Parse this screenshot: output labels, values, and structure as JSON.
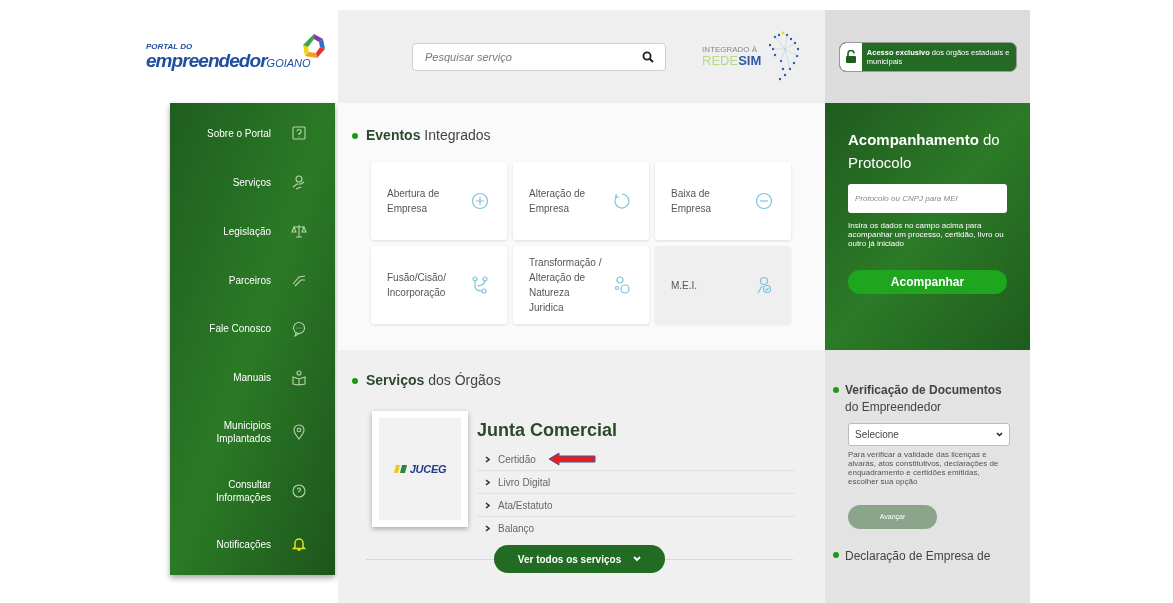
{
  "logo": {
    "small": "PORTAL DO",
    "main": "empreendedor",
    "suffix": "GOIANO"
  },
  "search": {
    "placeholder": "Pesquisar serviço"
  },
  "redesim": {
    "label": "INTEGRADO À",
    "rede": "REDE",
    "sim": "SIM"
  },
  "access_button": {
    "label": "**Acesso exclusivo** dos órgãos estaduais e municipais"
  },
  "sidebar": {
    "items": [
      {
        "label": "Sobre o Portal"
      },
      {
        "label": "Serviços"
      },
      {
        "label": "Legislação"
      },
      {
        "label": "Parceiros"
      },
      {
        "label": "Fale Conosco"
      },
      {
        "label": "Manuais"
      },
      {
        "label": "Municipios Implantados"
      },
      {
        "label": "Consultar Informações"
      },
      {
        "label": "Notificações"
      }
    ]
  },
  "events": {
    "title_bold": "Eventos",
    "title_rest": "Integrados",
    "cards": [
      {
        "label": "Abertura de Empresa",
        "highlighted": false
      },
      {
        "label": "Alteração de Empresa",
        "highlighted": false
      },
      {
        "label": "Baixa de Empresa",
        "highlighted": false
      },
      {
        "label": "Fusão/Cisão/ Incorporação",
        "highlighted": false
      },
      {
        "label": "Transformação / Alteração de Natureza Juridica",
        "highlighted": false
      },
      {
        "label": "M.E.I.",
        "highlighted": true
      }
    ]
  },
  "services": {
    "title_bold": "Serviços",
    "title_rest": "dos Órgãos",
    "organ": {
      "logo_text": "JUCEG",
      "name": "Junta Comercial",
      "links": [
        {
          "label": "Certidão",
          "highlighted": true
        },
        {
          "label": "Livro Digital",
          "highlighted": false
        },
        {
          "label": "Ata/Estatuto",
          "highlighted": false
        },
        {
          "label": "Balanço",
          "highlighted": false
        }
      ]
    },
    "more_button": "Ver todos os serviços"
  },
  "protocol": {
    "title": "**Acompanhamento** do Protocolo",
    "placeholder": "Protocolo ou CNPJ para MEI",
    "help": "Insira os dados no campo acima para acompanhar um processo, certidão, livro ou outro já iniciado",
    "button": "Acompanhar"
  },
  "verification": {
    "title": "**Verificação de Documentos** do Empreendedor",
    "select_value": "Selecione",
    "help": "Para verificar a validade das licenças e alvarás, atos constitutivos, declarações de enquadramento e certidões emitidas, escolher sua opção",
    "button": "Avançar",
    "button_disabled": true
  },
  "declaration": {
    "title": "Declaração de Empresa de"
  }
}
